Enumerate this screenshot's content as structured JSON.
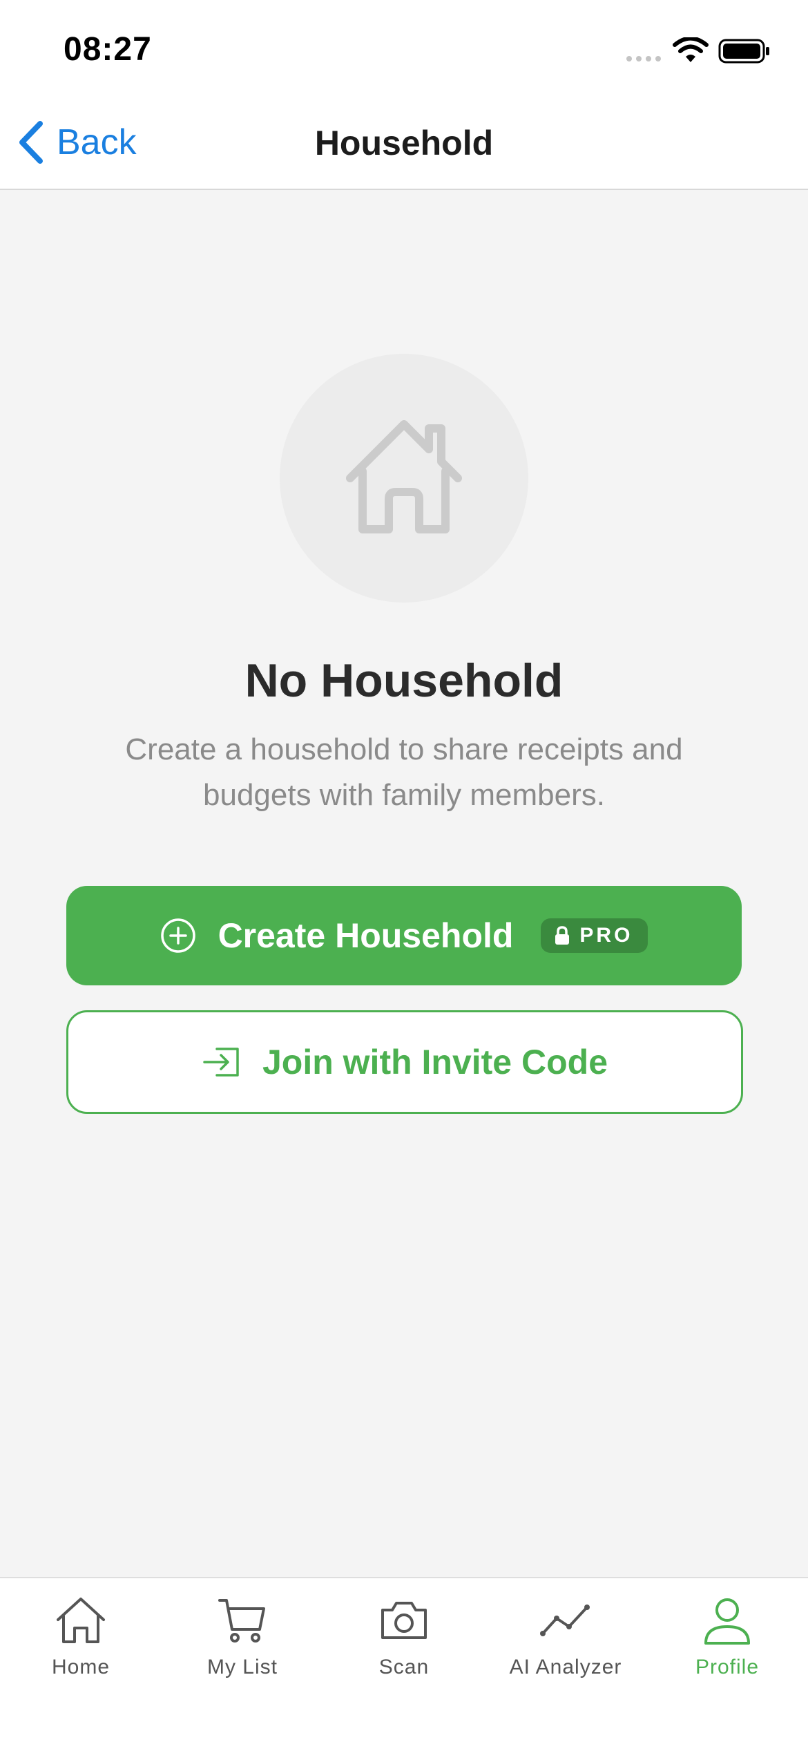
{
  "status_bar": {
    "time": "08:27"
  },
  "nav": {
    "back_label": "Back",
    "title": "Household"
  },
  "empty_state": {
    "icon": "house-icon",
    "title": "No Household",
    "description": "Create a household to share receipts and budgets with family members."
  },
  "actions": {
    "create_label": "Create Household",
    "create_icon": "plus-circle-icon",
    "pro_badge": "PRO",
    "join_label": "Join with Invite Code",
    "join_icon": "enter-icon"
  },
  "tabs": [
    {
      "label": "Home",
      "icon": "home-icon",
      "active": false
    },
    {
      "label": "My List",
      "icon": "cart-icon",
      "active": false
    },
    {
      "label": "Scan",
      "icon": "camera-icon",
      "active": false
    },
    {
      "label": "AI Analyzer",
      "icon": "trend-line-icon",
      "active": false
    },
    {
      "label": "Profile",
      "icon": "person-icon",
      "active": true
    }
  ],
  "colors": {
    "accent_green": "#4cb050",
    "badge_green": "#3a8a3e",
    "link_blue": "#1a7fe0",
    "background": "#f4f4f4",
    "inactive_tab": "#555555"
  }
}
